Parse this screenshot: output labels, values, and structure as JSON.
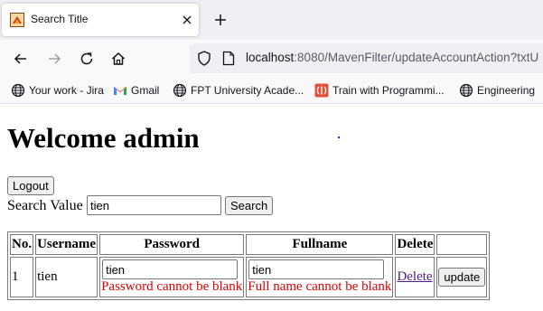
{
  "browser": {
    "tab_title": "Search Title",
    "url_host": "localhost",
    "url_rest": ":8080/MavenFilter/updateAccountAction?txtU",
    "bookmarks": [
      {
        "label": "Your work - Jira",
        "icon": "globe-icon"
      },
      {
        "label": "Gmail",
        "icon": "gmail-icon"
      },
      {
        "label": "FPT University Acade...",
        "icon": "globe-icon"
      },
      {
        "label": "Train with Programmi...",
        "icon": "codewars-icon"
      },
      {
        "label": "Engineering",
        "icon": "globe-icon"
      }
    ]
  },
  "page": {
    "heading": "Welcome admin",
    "logout_label": "Logout",
    "search_label": "Search Value",
    "search_value": "tien",
    "search_button": "Search",
    "table": {
      "headers": [
        "No.",
        "Username",
        "Password",
        "Fullname",
        "Delete",
        ""
      ],
      "rows": [
        {
          "no": "1",
          "username": "tien",
          "password": "tien",
          "password_error": "Password cannot be blank",
          "fullname": "tien",
          "fullname_error": "Full name cannot be blank",
          "delete_label": "Delete",
          "update_label": "update"
        }
      ]
    }
  },
  "colors": {
    "error": "#e00000",
    "visited_link": "#551a8b"
  }
}
